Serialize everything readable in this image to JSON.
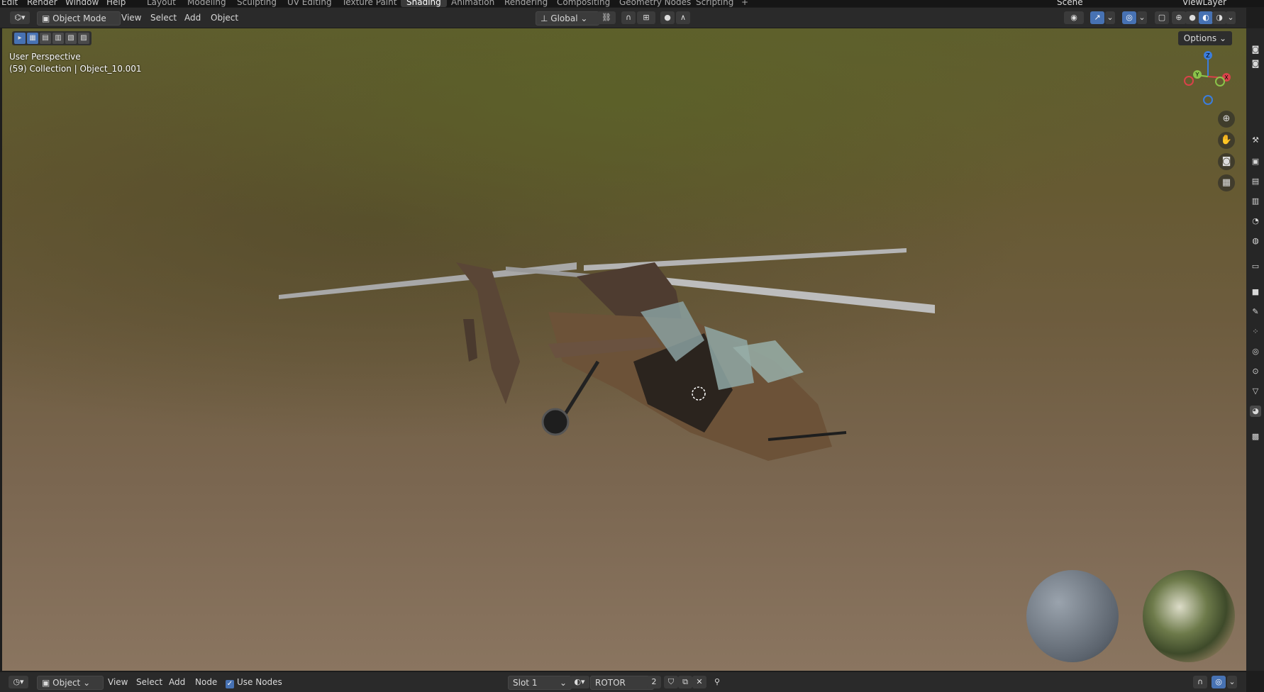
{
  "topbar": {
    "menus": [
      "Edit",
      "Render",
      "Window",
      "Help"
    ],
    "workspace_tabs": [
      "Layout",
      "Modeling",
      "Sculpting",
      "UV Editing",
      "Texture Paint",
      "Shading",
      "Animation",
      "Rendering",
      "Compositing",
      "Geometry Nodes",
      "Scripting"
    ],
    "active_tab": "Shading",
    "add_tab": "+",
    "scene_name": "Scene",
    "view_layer": "ViewLayer"
  },
  "viewport_header": {
    "mode": "Object Mode",
    "menus": [
      "View",
      "Select",
      "Add",
      "Object"
    ],
    "transform_orientation": "Global",
    "options_label": "Options"
  },
  "viewport": {
    "perspective_label": "User Perspective",
    "collection_label": "(59) Collection | Object_10.001",
    "gizmo_axes": {
      "z": "Z",
      "y": "Y",
      "x": "X"
    }
  },
  "node_header": {
    "object_dropdown": "Object",
    "menus": [
      "View",
      "Select",
      "Add",
      "Node"
    ],
    "use_nodes_label": "Use Nodes",
    "use_nodes_checked": true,
    "slot": "Slot 1",
    "material_name": "ROTOR",
    "user_count": "2"
  },
  "colors": {
    "accent": "#4772b3",
    "header_bg": "#2a2a2a",
    "axis_x": "#d9424a",
    "axis_y": "#8bc34a",
    "axis_z": "#3b7ddd"
  }
}
